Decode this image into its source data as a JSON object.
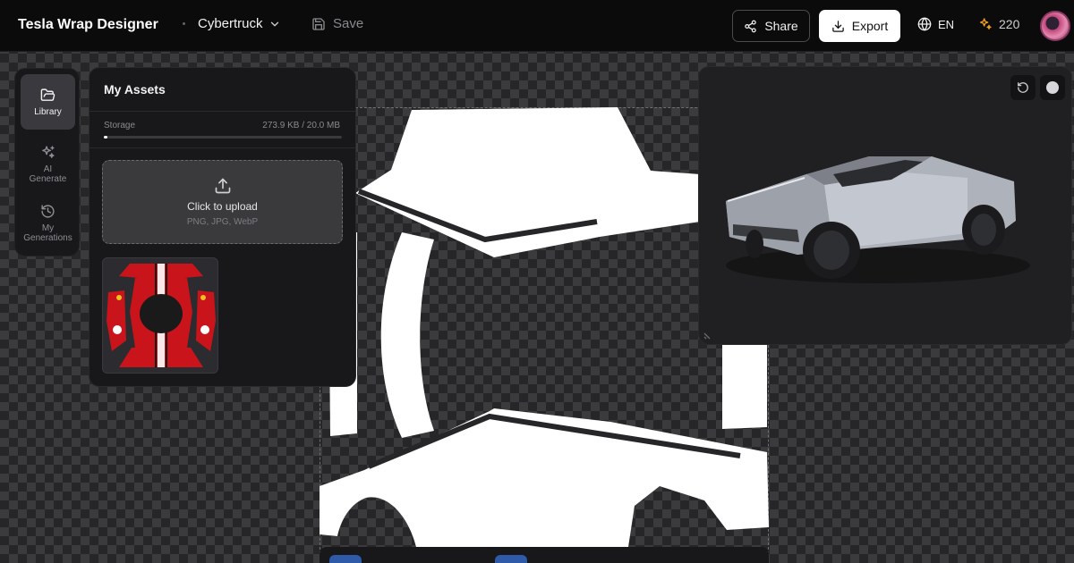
{
  "header": {
    "app_title": "Tesla Wrap Designer",
    "model": "Cybertruck",
    "save_label": "Save",
    "share_label": "Share",
    "export_label": "Export",
    "language": "EN",
    "credits": "220"
  },
  "sidebar": {
    "items": [
      {
        "label": "Library",
        "icon": "folder-open-icon",
        "active": true
      },
      {
        "label": "AI Generate",
        "icon": "sparkles-icon",
        "active": false
      },
      {
        "label": "My Generations",
        "icon": "history-icon",
        "active": false
      }
    ]
  },
  "assets": {
    "title": "My Assets",
    "storage_label": "Storage",
    "storage_value": "273.9 KB / 20.0 MB",
    "storage_fraction": 0.0134,
    "upload_label": "Click to upload",
    "upload_hint": "PNG, JPG, WebP"
  },
  "colors": {
    "accent": "#2f5aa8",
    "asset_red": "#c8141a",
    "credits_icon": "#f0a020"
  },
  "preview": {
    "icons": [
      "rotate-ccw-icon",
      "circle-color-icon"
    ]
  }
}
